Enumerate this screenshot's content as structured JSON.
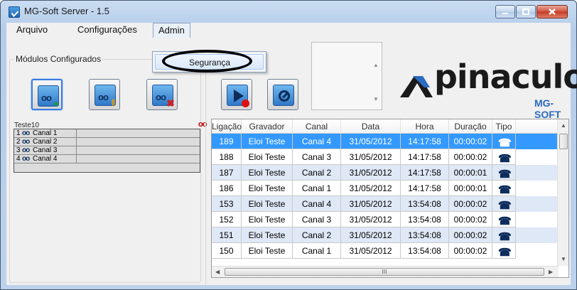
{
  "window": {
    "title": "MG-Soft Server - 1.5"
  },
  "menu": {
    "arquivo": "Arquivo",
    "configuracoes": "Configurações",
    "admin": "Admin"
  },
  "popup": {
    "seguranca": "Segurança"
  },
  "modules": {
    "label": "Módulos Configurados"
  },
  "device": {
    "name": "Teste10",
    "tape_glyph": "oo"
  },
  "channels": [
    {
      "num": "1",
      "tape": "oo",
      "name": "Canal 1"
    },
    {
      "num": "2",
      "tape": "oo",
      "name": "Canal 2"
    },
    {
      "num": "3",
      "tape": "oo",
      "name": "Canal 3"
    },
    {
      "num": "4",
      "tape": "oo",
      "name": "Canal 4"
    }
  ],
  "logo": {
    "text": "pinaculo",
    "sub": "MG-SOFT"
  },
  "grid": {
    "headers": [
      "Ligação",
      "Gravador",
      "Canal",
      "Data",
      "Hora",
      "Duração",
      "Tipo"
    ],
    "rows": [
      [
        "189",
        "Eloi Teste",
        "Canal 4",
        "31/05/2012",
        "14:17:58",
        "00:00:02"
      ],
      [
        "188",
        "Eloi Teste",
        "Canal 3",
        "31/05/2012",
        "14:17:58",
        "00:00:02"
      ],
      [
        "187",
        "Eloi Teste",
        "Canal 2",
        "31/05/2012",
        "14:17:58",
        "00:00:01"
      ],
      [
        "186",
        "Eloi Teste",
        "Canal 1",
        "31/05/2012",
        "14:17:58",
        "00:00:01"
      ],
      [
        "153",
        "Eloi Teste",
        "Canal 4",
        "31/05/2012",
        "13:54:08",
        "00:00:02"
      ],
      [
        "152",
        "Eloi Teste",
        "Canal 3",
        "31/05/2012",
        "13:54:08",
        "00:00:02"
      ],
      [
        "151",
        "Eloi Teste",
        "Canal 2",
        "31/05/2012",
        "13:54:08",
        "00:00:02"
      ],
      [
        "150",
        "Eloi Teste",
        "Canal 1",
        "31/05/2012",
        "13:54:08",
        "00:00:02"
      ]
    ],
    "selected_row": 0,
    "hscroll_grip": "III"
  },
  "colors": {
    "selection": "#3399ff",
    "alt_row": "#dfe8f6",
    "logo_accent": "#2a6ac0"
  },
  "icons": [
    "app-icon",
    "minimize-icon",
    "maximize-icon",
    "close-icon",
    "add-device-icon",
    "edit-device-icon",
    "remove-device-icon",
    "play-record-icon",
    "stop-icon",
    "incoming-call-icon"
  ]
}
